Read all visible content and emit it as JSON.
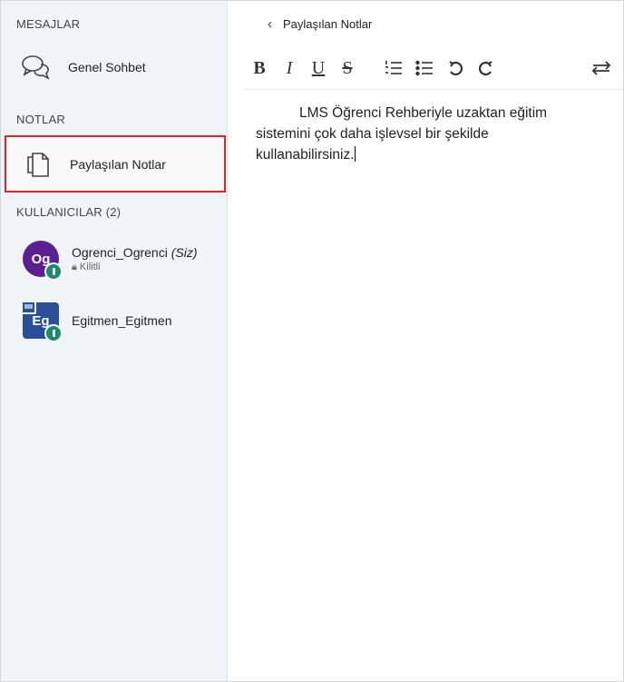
{
  "sidebar": {
    "messages_title": "MESAJLAR",
    "public_chat": {
      "label": "Genel Sohbet",
      "icon": "chat-bubbles-icon"
    },
    "notes_title": "NOTLAR",
    "shared_notes": {
      "label": "Paylaşılan Notlar",
      "icon": "documents-icon",
      "selected": true
    },
    "users_title": "KULLANICILAR (2)",
    "users": [
      {
        "initials": "Og",
        "name": "Ogrenci_Ogrenci",
        "you": "(Siz)",
        "status": "Kilitli",
        "color": "#5b1f92"
      },
      {
        "initials": "Eg",
        "name": "Egitmen_Egitmen",
        "color": "#2b4e98"
      }
    ]
  },
  "notes_panel": {
    "back_icon": "chevron-left-icon",
    "title": "Paylaşılan Notlar",
    "toolbar": {
      "bold": "B",
      "italic": "I",
      "underline": "U",
      "strike": "S",
      "ordered_list_icon": "ordered-list-icon",
      "bullet_list_icon": "bullet-list-icon",
      "undo_icon": "undo-icon",
      "redo_icon": "redo-icon",
      "ltr_rtl_icon": "swap-arrows-icon"
    },
    "content": {
      "line1": "LMS Öğrenci Rehberiyle uzaktan eğitim",
      "line2": "sistemini çok daha işlevsel bir şekilde",
      "line3": "kullanabilirsiniz."
    }
  },
  "colors": {
    "sidebar_bg": "#f1f4f7",
    "selection_border": "#e1242b",
    "mic_badge": "#1b8a6e"
  }
}
